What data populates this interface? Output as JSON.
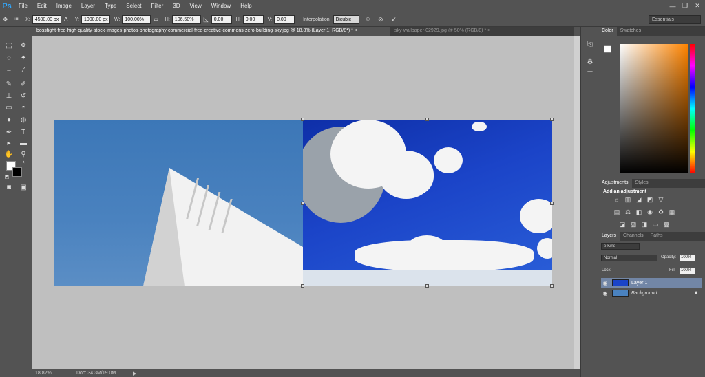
{
  "app": {
    "logo": "Ps"
  },
  "menu": [
    "File",
    "Edit",
    "Image",
    "Layer",
    "Type",
    "Select",
    "Filter",
    "3D",
    "View",
    "Window",
    "Help"
  ],
  "options": {
    "x_label": "X:",
    "x_value": "4500.00 px",
    "y_label": "Y:",
    "y_value": "1000.00 px",
    "w_label": "W:",
    "w_value": "100.00%",
    "h_label": "H:",
    "h_value": "106.50%",
    "rot_value": "0.00",
    "hskew_label": "H:",
    "hskew_value": "0.00",
    "vskew_label": "V:",
    "vskew_value": "0.00",
    "interp_label": "Interpolation:",
    "interp_value": "Bicubic",
    "workspace": "Essentials"
  },
  "tabs": [
    {
      "label": "bossfight-free-high-quality-stock-images-photos-photography-commercial-free-creative-commons-zero-building-sky.jpg @ 18.8% (Layer 1, RGB/8*) *  ×"
    },
    {
      "label": "sky-wallpaper-02929.jpg @ 50% (RGB/8) *  ×"
    }
  ],
  "status": {
    "zoom": "18.82%",
    "doc": "Doc: 34.3M/19.0M"
  },
  "color_panel": {
    "tabs": [
      "Color",
      "Swatches"
    ],
    "fg": "#ffffff",
    "bg": "#000000"
  },
  "adjustments": {
    "tabs": [
      "Adjustments",
      "Styles"
    ],
    "title": "Add an adjustment"
  },
  "layers_panel": {
    "tabs": [
      "Layers",
      "Channels",
      "Paths"
    ],
    "kind": "ρ Kind",
    "blend_mode": "Normal",
    "opacity_label": "Opacity:",
    "opacity_value": "100%",
    "lock_label": "Lock:",
    "fill_label": "Fill:",
    "fill_value": "100%",
    "layers": [
      {
        "name": "Layer 1",
        "selected": true
      },
      {
        "name": "Background",
        "selected": false
      }
    ]
  }
}
